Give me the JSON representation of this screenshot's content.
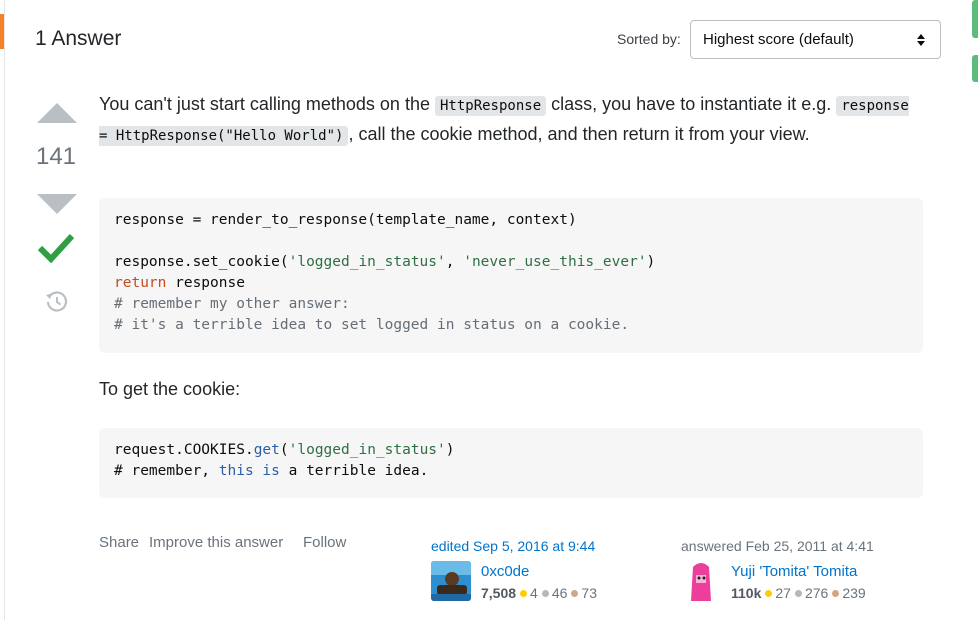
{
  "answers_header": {
    "title": "1 Answer",
    "sorted_label": "Sorted by:",
    "sort_selected": "Highest score (default)"
  },
  "answer": {
    "score": "141",
    "accepted": true,
    "body": {
      "p1_part1": "You can't just start calling methods on the ",
      "p1_code1": "HttpResponse",
      "p1_part2": " class, you have to instantiate it e.g. ",
      "p1_code2": "response = HttpResponse(\"Hello World\")",
      "p1_part3": ", call the cookie method, and then return it from your view.",
      "code1": {
        "line1": "response = render_to_response(template_name, context)",
        "line2_pre": "response.set_cookie(",
        "line2_str1": "'logged_in_status'",
        "line2_mid": ", ",
        "line2_str2": "'never_use_this_ever'",
        "line2_post": ")",
        "line3_kw": "return",
        "line3_rest": " response",
        "line4": "# remember my other answer:",
        "line5": "# it's a terrible idea to set logged in status on a cookie."
      },
      "p2": "To get the cookie:",
      "code2": {
        "line1_pre": "request.COOKIES.",
        "line1_fn": "get",
        "line1_open": "(",
        "line1_str": "'logged_in_status'",
        "line1_close": ")",
        "line2_a": "# remember, ",
        "line2_b": "this",
        "line2_c": " ",
        "line2_d": "is",
        "line2_e": " a terrible idea."
      }
    },
    "menu": {
      "share": "Share",
      "improve": "Improve this answer",
      "follow": "Follow"
    },
    "editor": {
      "label": "edited Sep 5, 2016 at 9:44",
      "name": "0xc0de",
      "reputation": "7,508",
      "gold": "4",
      "silver": "46",
      "bronze": "73"
    },
    "author": {
      "label": "answered Feb 25, 2011 at 4:41",
      "name": "Yuji 'Tomita' Tomita",
      "reputation": "110k",
      "gold": "27",
      "silver": "276",
      "bronze": "239"
    }
  },
  "colors": {
    "accent_orange": "#f48225",
    "link_blue": "#0074cc",
    "accepted_green": "#2f9e44",
    "vote_gray": "#babfc4"
  },
  "icons": [
    "vote-up-icon",
    "vote-down-icon",
    "accepted-check-icon",
    "history-icon",
    "sort-caret-icon"
  ]
}
